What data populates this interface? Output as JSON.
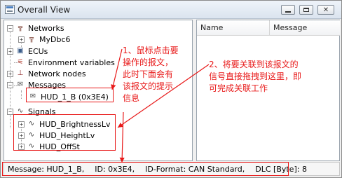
{
  "window": {
    "title": "Overall View"
  },
  "tree": {
    "networks_label": "Networks",
    "mydbc_label": "MyDbc6",
    "ecus_label": "ECUs",
    "env_label": "Environment variables",
    "nodes_label": "Network nodes",
    "messages_label": "Messages",
    "message_item": "HUD_1_B (0x3E4)",
    "signals_label": "Signals",
    "signals": [
      "HUD_BrightnessLv",
      "HUD_HeightLv",
      "HUD_OffSt"
    ]
  },
  "right_pane": {
    "columns": [
      "Name",
      "Message"
    ]
  },
  "statusbar": {
    "message": "Message: HUD_1_B,",
    "id": "ID: 0x3E4,",
    "format": "ID-Format: CAN Standard,",
    "dlc": "DLC [Byte]: 8"
  },
  "annotations": {
    "note1": [
      "1、鼠标点击要",
      "操作的报文，",
      "此时下面会有",
      "该报文的提示",
      "信息"
    ],
    "note2": [
      "2、将要关联到该报文的",
      "信号直接拖拽到这里，即",
      "可完成关联工作"
    ]
  },
  "colors": {
    "annotation": "#e81818",
    "window_bg": "#f0f0f0"
  }
}
